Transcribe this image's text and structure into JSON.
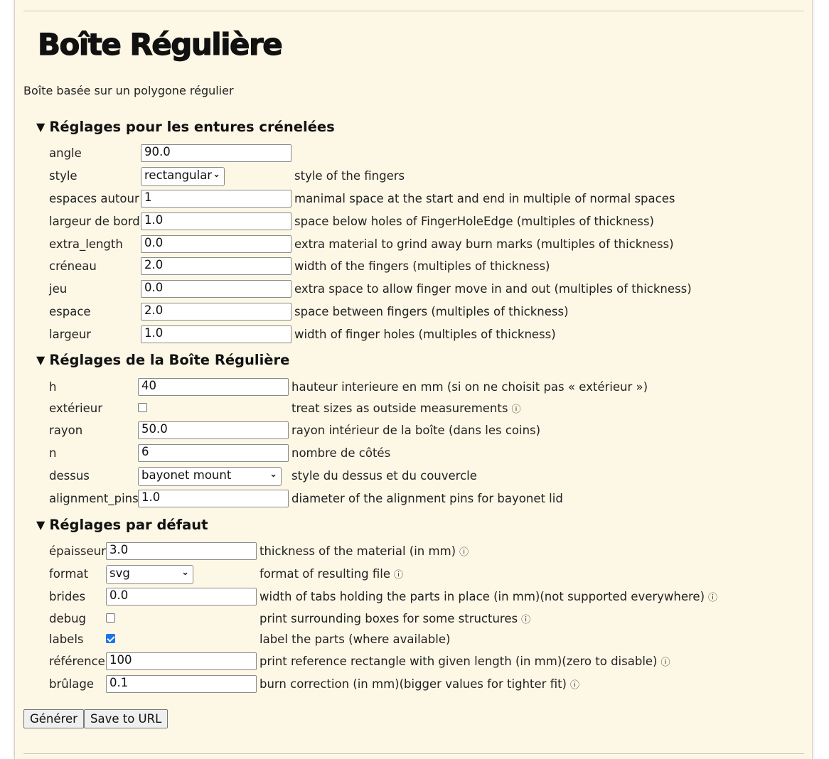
{
  "title": "Boîte Régulière",
  "description": "Boîte basée sur un polygone régulier",
  "sections": {
    "finger": {
      "title": "Réglages pour les entures crénelées",
      "rows": [
        {
          "label": "angle",
          "value": "90.0",
          "help": ""
        },
        {
          "label": "style",
          "value": "rectangular",
          "help": "style of the fingers"
        },
        {
          "label": "espaces autour",
          "value": "1",
          "help": "manimal space at the start and end in multiple of normal spaces"
        },
        {
          "label": "largeur de bord",
          "value": "1.0",
          "help": "space below holes of FingerHoleEdge (multiples of thickness)"
        },
        {
          "label": "extra_length",
          "value": "0.0",
          "help": "extra material to grind away burn marks (multiples of thickness)"
        },
        {
          "label": "créneau",
          "value": "2.0",
          "help": "width of the fingers (multiples of thickness)"
        },
        {
          "label": "jeu",
          "value": "0.0",
          "help": "extra space to allow finger move in and out (multiples of thickness)"
        },
        {
          "label": "espace",
          "value": "2.0",
          "help": "space between fingers (multiples of thickness)"
        },
        {
          "label": "largeur",
          "value": "1.0",
          "help": "width of finger holes (multiples of thickness)"
        }
      ]
    },
    "box": {
      "title": "Réglages de la Boîte Régulière",
      "rows": [
        {
          "label": "h",
          "value": "40",
          "help": "hauteur interieure en mm (si on ne choisit pas « extérieur »)"
        },
        {
          "label": "extérieur",
          "checked": false,
          "help": "treat sizes as outside measurements"
        },
        {
          "label": "rayon",
          "value": "50.0",
          "help": "rayon intérieur de la boîte (dans les coins)"
        },
        {
          "label": "n",
          "value": "6",
          "help": "nombre de côtés"
        },
        {
          "label": "dessus",
          "value": "bayonet mount",
          "help": "style du dessus et du couvercle"
        },
        {
          "label": "alignment_pins",
          "value": "1.0",
          "help": "diameter of the alignment pins for bayonet lid"
        }
      ]
    },
    "defaults": {
      "title": "Réglages par défaut",
      "rows": [
        {
          "label": "épaisseur",
          "value": "3.0",
          "help": "thickness of the material (in mm)"
        },
        {
          "label": "format",
          "value": "svg",
          "help": "format of resulting file"
        },
        {
          "label": "brides",
          "value": "0.0",
          "help": "width of tabs holding the parts in place (in mm)(not supported everywhere)"
        },
        {
          "label": "debug",
          "checked": false,
          "help": "print surrounding boxes for some structures"
        },
        {
          "label": "labels",
          "checked": true,
          "help": "label the parts (where available)"
        },
        {
          "label": "référence",
          "value": "100",
          "help": "print reference rectangle with given length (in mm)(zero to disable)"
        },
        {
          "label": "brûlage",
          "value": "0.1",
          "help": "burn correction (in mm)(bigger values for tighter fit)"
        }
      ]
    }
  },
  "buttons": {
    "generate": "Générer",
    "save_url": "Save to URL"
  },
  "icons": {
    "info": "ⓘ",
    "triangle": "▼",
    "chevron": "⌄"
  },
  "colors": {
    "page_bg": "#fdf7e6",
    "checkbox_on": "#1a73e8"
  }
}
